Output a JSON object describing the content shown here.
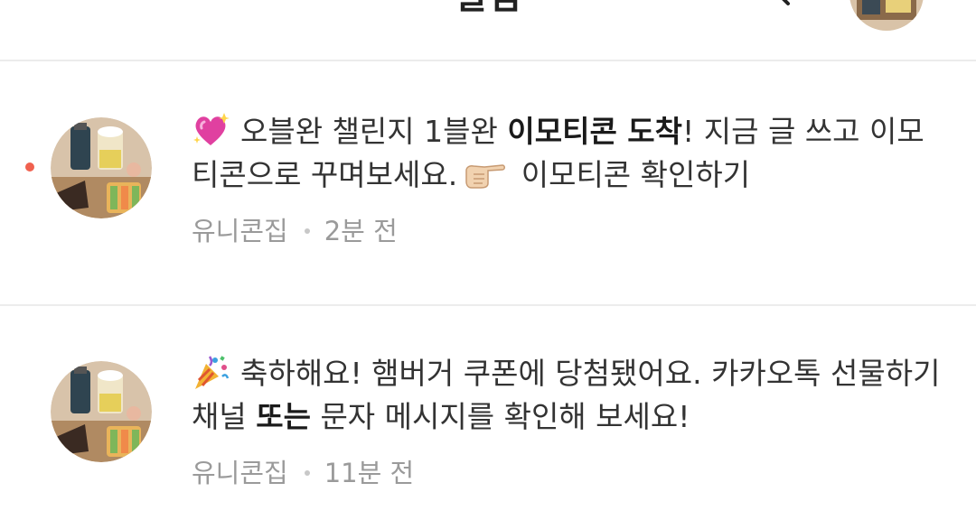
{
  "header": {
    "title": "알림",
    "search_icon": "search-icon",
    "avatar_icon": "profile-avatar"
  },
  "notifications": [
    {
      "unread": true,
      "emoji": "sparkling-heart-icon",
      "text_1": "오블완 챌린지 1블완 ",
      "bold_1": "이모티콘 도착",
      "text_2": "! 지금 글 쓰고 이모티콘으로 꾸며보세요.",
      "pointer_emoji": "pointing-right-hand-icon",
      "text_3": " 이모티콘 확인하기",
      "author": "유니콘집",
      "time": "2분 전"
    },
    {
      "unread": false,
      "emoji": "party-popper-icon",
      "text_1": "축하해요! 햄버거 쿠폰에 당첨됐어요. 카카오톡 선물하기 채널 ",
      "bold_1": "또는",
      "text_2": " 문자 메시지를 확인해 보세요!",
      "author": "유니콘집",
      "time": "11분 전"
    }
  ],
  "colors": {
    "unread_dot": "#f0614f",
    "divider": "#ececec",
    "meta_text": "#9a9a9a"
  }
}
